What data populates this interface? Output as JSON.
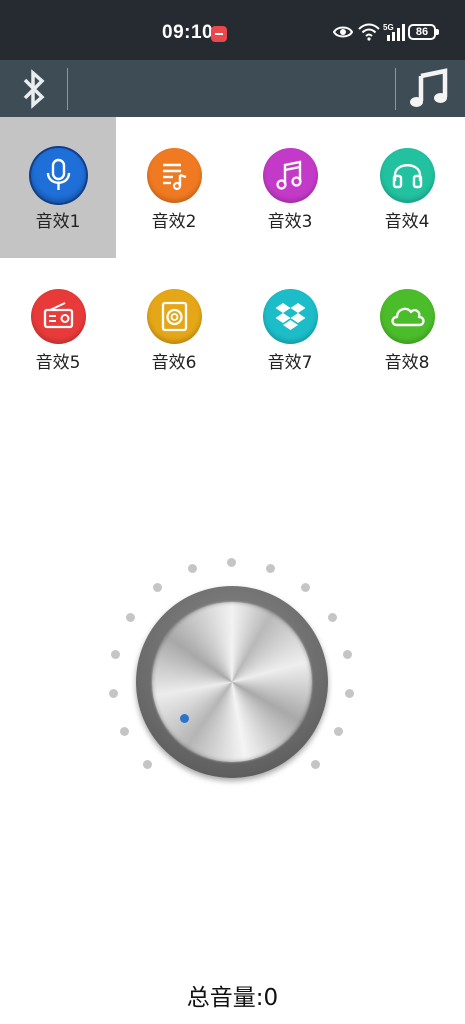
{
  "status_bar": {
    "time": "09:10",
    "network": "5G",
    "battery": "86"
  },
  "toolbar": {
    "bluetooth_icon": "bluetooth-icon",
    "music_icon": "music-note-icon"
  },
  "effects": [
    {
      "label": "音效1",
      "icon": "microphone-icon",
      "color": "#1f6fd8",
      "selected": true
    },
    {
      "label": "音效2",
      "icon": "playlist-icon",
      "color": "#f07a22",
      "selected": false
    },
    {
      "label": "音效3",
      "icon": "music-note-icon",
      "color": "#c43ac8",
      "selected": false
    },
    {
      "label": "音效4",
      "icon": "headphones-icon",
      "color": "#22c2a0",
      "selected": false
    },
    {
      "label": "音效5",
      "icon": "radio-icon",
      "color": "#e93a3a",
      "selected": false
    },
    {
      "label": "音效6",
      "icon": "speaker-icon",
      "color": "#e5a617",
      "selected": false
    },
    {
      "label": "音效7",
      "icon": "dropbox-icon",
      "color": "#1cbdc8",
      "selected": false
    },
    {
      "label": "音效8",
      "icon": "cloud-icon",
      "color": "#4cbd2a",
      "selected": false
    }
  ],
  "volume": {
    "label": "总音量:0",
    "value": 0
  },
  "colors": {
    "status_bar_bg": "#252b30",
    "toolbar_bg": "#3e4d55",
    "selected_cell_bg": "#c4c4c4",
    "knob_indicator": "#2e73c7"
  }
}
